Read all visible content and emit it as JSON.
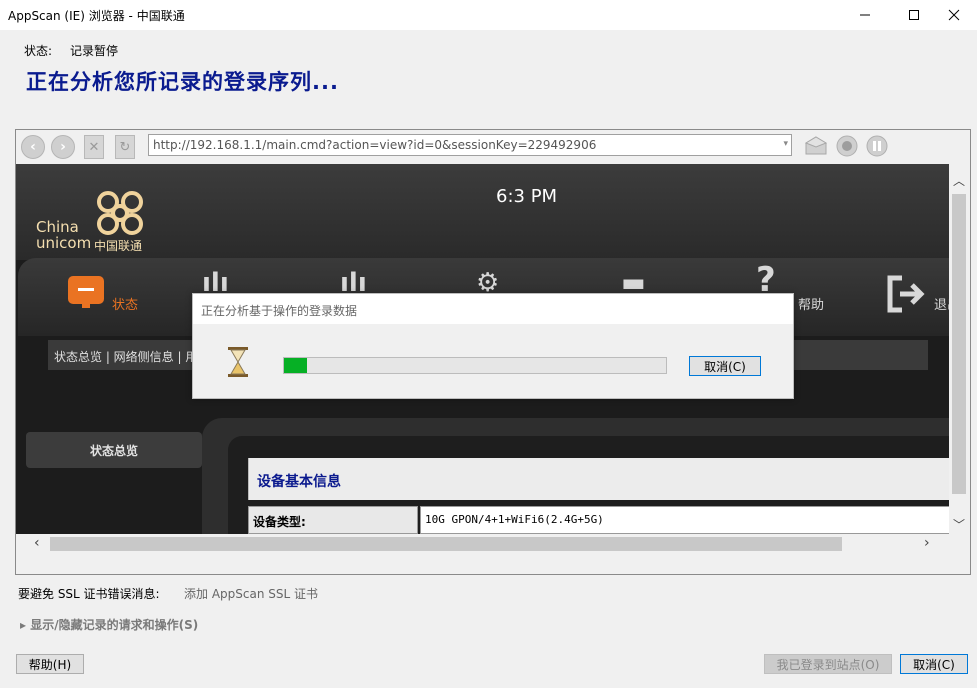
{
  "window": {
    "title": "AppScan (IE) 浏览器 - 中国联通",
    "controls": [
      "minimize-icon",
      "maximize-icon",
      "close-icon"
    ]
  },
  "status": {
    "label": "状态:",
    "value": "记录暂停"
  },
  "heading": "正在分析您所记录的登录序列...",
  "browser": {
    "url": "http://192.168.1.1/main.cmd?action=view?id=0&sessionKey=229492906",
    "nav_icons": [
      "back-icon",
      "forward-icon",
      "stop-icon",
      "refresh-icon",
      "home-icon",
      "record-icon",
      "pause-icon"
    ]
  },
  "router_page": {
    "time": "6:3 PM",
    "logo_china": "China",
    "logo_unicom": "unicom",
    "logo_cn": "中国联通",
    "nav": {
      "state_label": "状态",
      "help_label": "帮助",
      "exit_label": "退出"
    },
    "subnav": "状态总览 | 网络侧信息 | 用",
    "sidebar_item": "状态总览",
    "section_title": "设备基本信息",
    "row": {
      "label": "设备类型:",
      "value": "10G GPON/4+1+WiFi6(2.4G+5G)"
    }
  },
  "dialog": {
    "title": "正在分析基于操作的登录数据",
    "progress": 0.06,
    "cancel_label": "取消(C)"
  },
  "bottom": {
    "ssl_label": "要避免 SSL 证书错误消息:",
    "ssl_link": "添加 AppScan SSL 证书",
    "toggle_label": "▸ 显示/隐藏记录的请求和操作(S)",
    "help_button": "帮助(H)",
    "logged_in_button": "我已登录到站点(O)",
    "cancel_button": "取消(C)"
  },
  "colors": {
    "heading": "#0a1b8f",
    "accent_orange": "#ea7322",
    "progress_green": "#06b025",
    "focus_border": "#0078d7"
  }
}
